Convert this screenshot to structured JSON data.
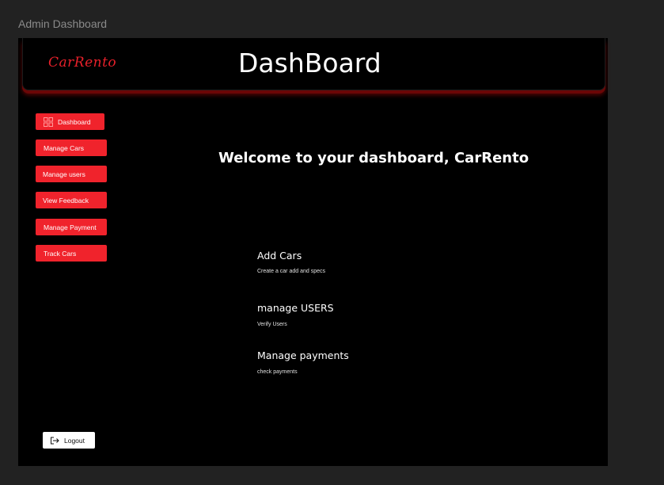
{
  "frame": {
    "label": "Admin Dashboard"
  },
  "header": {
    "logo_text": "CarRento",
    "title": "DashBoard"
  },
  "sidebar": {
    "items": [
      {
        "label": "Dashboard",
        "icon": "grid-icon"
      },
      {
        "label": "Manage Cars"
      },
      {
        "label": "Manage users"
      },
      {
        "label": "View Feedback"
      },
      {
        "label": "Manage Payment"
      },
      {
        "label": "Track Cars"
      }
    ],
    "logout_label": "Logout"
  },
  "main": {
    "welcome": "Welcome to your dashboard, CarRento",
    "cards": [
      {
        "title": "Add Cars",
        "subtitle": "Create a car add and specs"
      },
      {
        "title": "manage USERS",
        "subtitle": "Verify Users"
      },
      {
        "title": "Manage payments",
        "subtitle": "check payments"
      }
    ]
  },
  "colors": {
    "accent": "#f0232c",
    "background": "#000000",
    "page": "#222222"
  }
}
